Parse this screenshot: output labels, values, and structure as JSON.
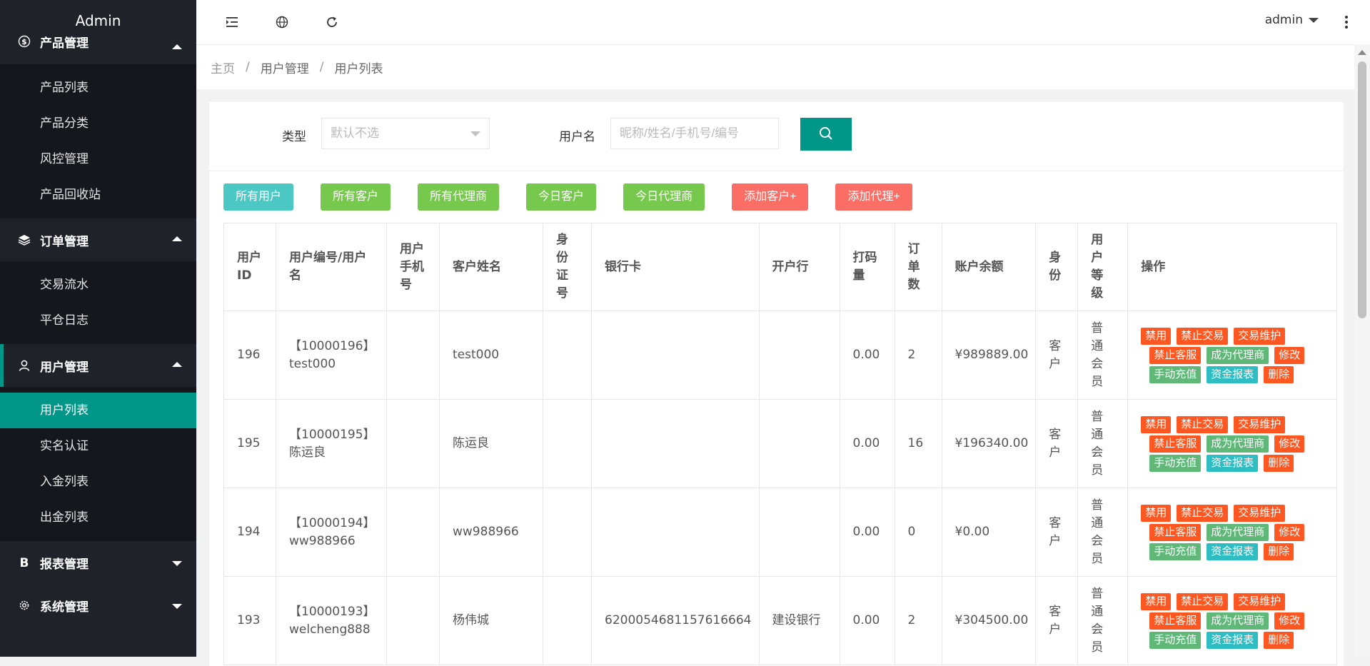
{
  "sidebar": {
    "brand": "Admin",
    "groups": [
      {
        "label": "产品管理",
        "icon": "dollar-circle-icon",
        "expanded": true,
        "items": [
          "产品列表",
          "产品分类",
          "风控管理",
          "产品回收站"
        ]
      },
      {
        "label": "订单管理",
        "icon": "layers-icon",
        "expanded": true,
        "items": [
          "交易流水",
          "平仓日志"
        ]
      },
      {
        "label": "用户管理",
        "icon": "user-icon",
        "expanded": true,
        "items": [
          "用户列表",
          "实名认证",
          "入金列表",
          "出金列表"
        ]
      },
      {
        "label": "报表管理",
        "icon": "bold-b-icon",
        "expanded": false,
        "items": []
      },
      {
        "label": "系统管理",
        "icon": "gear-icon",
        "expanded": false,
        "items": []
      }
    ],
    "active_item": "用户列表"
  },
  "header": {
    "username": "admin"
  },
  "breadcrumb": [
    "主页",
    "用户管理",
    "用户列表"
  ],
  "search": {
    "type_label": "类型",
    "type_value": "默认不选",
    "username_label": "用户名",
    "username_placeholder": "昵称/姓名/手机号/编号"
  },
  "filters": [
    {
      "label": "所有用户",
      "color": "#4bc8c4"
    },
    {
      "label": "所有客户",
      "color": "#77c94d"
    },
    {
      "label": "所有代理商",
      "color": "#77c94d"
    },
    {
      "label": "今日客户",
      "color": "#77c94d"
    },
    {
      "label": "今日代理商",
      "color": "#77c94d"
    },
    {
      "label": "添加客户+",
      "color": "#fb6e66"
    },
    {
      "label": "添加代理+",
      "color": "#fb6e66"
    }
  ],
  "table": {
    "columns": [
      {
        "label": "用户\nID",
        "width": 73
      },
      {
        "label": "用户编号/用户\n名",
        "width": 155
      },
      {
        "label": "用户\n手机\n号",
        "width": 74
      },
      {
        "label": "客户姓名",
        "width": 145
      },
      {
        "label": "身\n份\n证\n号",
        "width": 68
      },
      {
        "label": "银行卡",
        "width": 224
      },
      {
        "label": "开户行",
        "width": 113
      },
      {
        "label": "打码\n量",
        "width": 77
      },
      {
        "label": "订\n单\n数",
        "width": 66
      },
      {
        "label": "账户余额",
        "width": 131
      },
      {
        "label": "身\n份",
        "width": 59
      },
      {
        "label": "用\n户\n等\n级",
        "width": 70
      },
      {
        "label": "操作",
        "width": 293
      }
    ],
    "rows": [
      {
        "id": "196",
        "code": "【10000196】\ntest000",
        "phone": "",
        "name": "test000",
        "idcard": "",
        "bankcard": "",
        "bank": "",
        "bet": "0.00",
        "orders": "2",
        "balance": "¥989889.00",
        "role": "客\n户",
        "level": "普\n通\n会\n员"
      },
      {
        "id": "195",
        "code": "【10000195】\n陈运良",
        "phone": "",
        "name": "陈运良",
        "idcard": "",
        "bankcard": "",
        "bank": "",
        "bet": "0.00",
        "orders": "16",
        "balance": "¥196340.00",
        "role": "客\n户",
        "level": "普\n通\n会\n员"
      },
      {
        "id": "194",
        "code": "【10000194】\nww988966",
        "phone": "",
        "name": "ww988966",
        "idcard": "",
        "bankcard": "",
        "bank": "",
        "bet": "0.00",
        "orders": "0",
        "balance": "¥0.00",
        "role": "客\n户",
        "level": "普\n通\n会\n员"
      },
      {
        "id": "193",
        "code": "【10000193】\nwelcheng888",
        "phone": "",
        "name": "杨伟城",
        "idcard": "",
        "bankcard": "6200054681157616664",
        "bank": "建设银行",
        "bet": "0.00",
        "orders": "2",
        "balance": "¥304500.00",
        "role": "客\n户",
        "level": "普\n通\n会\n员"
      }
    ],
    "actions": [
      [
        {
          "label": "禁用",
          "color": "#ff5722"
        },
        {
          "label": "禁止交易",
          "color": "#ff5722"
        },
        {
          "label": "交易维护",
          "color": "#ff5722"
        }
      ],
      [
        {
          "label": "禁止客服",
          "color": "#ff5722"
        },
        {
          "label": "成为代理商",
          "color": "#5fb878"
        },
        {
          "label": "修改",
          "color": "#ff5722"
        }
      ],
      [
        {
          "label": "手动充值",
          "color": "#5fb878"
        },
        {
          "label": "资金报表",
          "color": "#2fbdc4"
        },
        {
          "label": "删除",
          "color": "#ff5722"
        }
      ]
    ]
  },
  "colors": {
    "accent": "#009688",
    "sidebar_bg": "#20222a",
    "submenu_bg": "#15171c"
  }
}
